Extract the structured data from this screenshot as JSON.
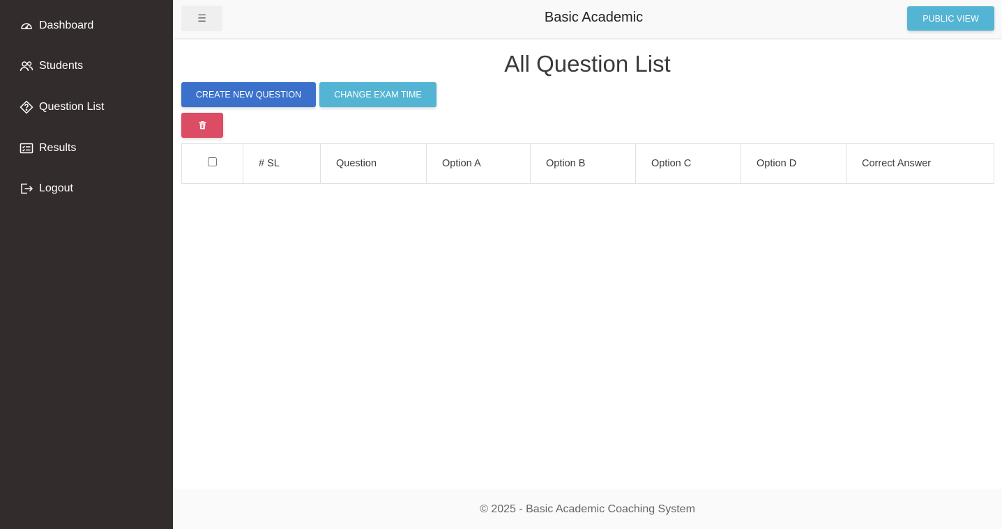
{
  "sidebar": {
    "items": [
      {
        "label": "Dashboard",
        "icon": "gauge-icon"
      },
      {
        "label": "Students",
        "icon": "users-icon"
      },
      {
        "label": "Question List",
        "icon": "question-tag-icon"
      },
      {
        "label": "Results",
        "icon": "list-card-icon"
      },
      {
        "label": "Logout",
        "icon": "logout-icon"
      }
    ]
  },
  "header": {
    "menu_icon": "☰",
    "brand": "Basic Academic",
    "public_view_label": "PUBLIC VIEW"
  },
  "main": {
    "title": "All Question List",
    "create_label": "CREATE NEW QUESTION",
    "change_time_label": "CHANGE EXAM TIME",
    "delete_icon": "trash-icon"
  },
  "table": {
    "columns": [
      "# SL",
      "Question",
      "Option A",
      "Option B",
      "Option C",
      "Option D",
      "Correct Answer"
    ],
    "rows": []
  },
  "footer": {
    "text": "© 2025 - Basic Academic Coaching System"
  },
  "colors": {
    "sidebar_bg": "#322c2c",
    "primary": "#3b71ca",
    "info": "#54b4d3",
    "danger": "#dc4c64"
  }
}
